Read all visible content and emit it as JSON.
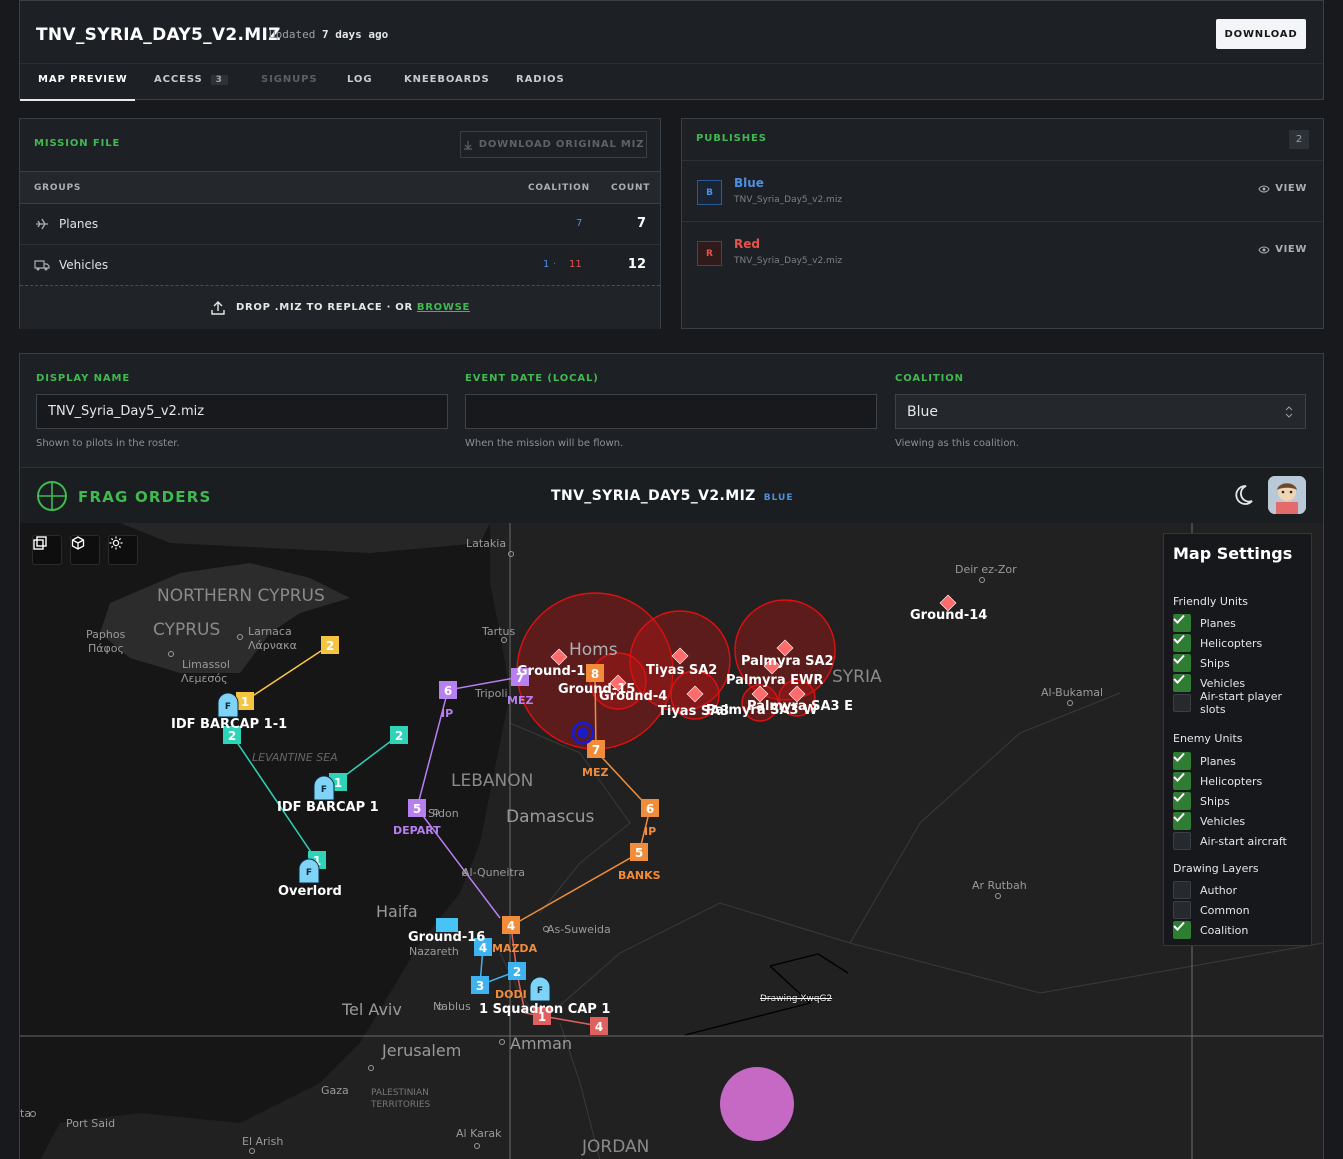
{
  "header": {
    "title": "TNV_SYRIA_DAY5_V2.MIZ",
    "updated_label": "Updated",
    "updated_value": "7 days ago",
    "download_label": "DOWNLOAD"
  },
  "tabs": [
    {
      "label": "MAP PREVIEW"
    },
    {
      "label": "ACCESS",
      "badge": "3"
    },
    {
      "label": "SIGNUPS"
    },
    {
      "label": "LOG"
    },
    {
      "label": "KNEEBOARDS"
    },
    {
      "label": "RADIOS"
    }
  ],
  "mission": {
    "title": "MISSION FILE",
    "download_original": "DOWNLOAD ORIGINAL MIZ",
    "col_groups": "GROUPS",
    "col_coalition": "COALITION",
    "col_count": "COUNT",
    "rows": [
      {
        "name": "Planes",
        "blue": "7",
        "red": "",
        "count": "7"
      },
      {
        "name": "Vehicles",
        "blue": "1",
        "red": "11",
        "count": "12"
      }
    ],
    "drop_text": "DROP .MIZ TO REPLACE · OR",
    "browse": "BROWSE"
  },
  "publishes": {
    "title": "PUBLISHES",
    "count": "2",
    "items": [
      {
        "letter": "B",
        "name": "Blue",
        "file": "TNV_Syria_Day5_v2.miz",
        "view": "VIEW"
      },
      {
        "letter": "R",
        "name": "Red",
        "file": "TNV_Syria_Day5_v2.miz",
        "view": "VIEW"
      }
    ]
  },
  "form": {
    "display_name_label": "DISPLAY NAME",
    "display_name_value": "TNV_Syria_Day5_v2.miz",
    "display_name_hint": "Shown to pilots in the roster.",
    "event_date_label": "EVENT DATE (LOCAL)",
    "event_date_value": "",
    "event_date_hint": "When the mission will be flown.",
    "coalition_label": "COALITION",
    "coalition_value": "Blue",
    "coalition_hint": "Viewing as this coalition."
  },
  "frag": {
    "title": "FRAG ORDERS",
    "mission_name": "TNV_SYRIA_DAY5_V2.MIZ",
    "coalition_tag": "BLUE"
  },
  "map": {
    "places": [
      "Latakia",
      "Deir ez-Zor",
      "NORTHERN CYPRUS",
      "CYPRUS",
      "Paphos",
      "Πάφος",
      "Larnaca",
      "Λάρνακα",
      "Limassol",
      "Λεμεσός",
      "Tartus",
      "Homs",
      "Tripoli",
      "SYRIA",
      "Al-Bukamal",
      "LEVANTINE SEA",
      "LEBANON",
      "Damascus",
      "Sidon",
      "Al-Quneitra",
      "Haifa",
      "Nazareth",
      "As-Suweida",
      "Ar Rutbah",
      "Tel Aviv",
      "Nablus",
      "Jerusalem",
      "Amman",
      "Gaza",
      "PALESTINIAN",
      "TERRITORIES",
      "Al Karak",
      "Port Said",
      "El Arish",
      "JORDAN",
      "ta"
    ],
    "units": [
      "IDF BARCAP 1-1",
      "IDF BARCAP 1",
      "Overlord",
      "Ground-16",
      "Ground-14",
      "Tiyas SA2",
      "Palmyra SA2",
      "Palmyra EWR",
      "Ground-1",
      "Ground-4",
      "Ground-15",
      "Tiyas SA3",
      "Palmyra SA3 E",
      "Palmyra SA3 W",
      "1 Squadron CAP 1"
    ],
    "waypoint_labels": [
      "IP",
      "MEZ",
      "DEPART",
      "BANKS",
      "MAZDA",
      "DODI"
    ],
    "drawing": "Drawing-XwqG2"
  },
  "settings": {
    "title": "Map Settings",
    "friendly_title": "Friendly Units",
    "friendly": [
      {
        "label": "Planes",
        "on": true
      },
      {
        "label": "Helicopters",
        "on": true
      },
      {
        "label": "Ships",
        "on": true
      },
      {
        "label": "Vehicles",
        "on": true
      },
      {
        "label": "Air-start player slots",
        "on": false
      }
    ],
    "enemy_title": "Enemy Units",
    "enemy": [
      {
        "label": "Planes",
        "on": true
      },
      {
        "label": "Helicopters",
        "on": true
      },
      {
        "label": "Ships",
        "on": true
      },
      {
        "label": "Vehicles",
        "on": true
      },
      {
        "label": "Air-start aircraft",
        "on": false
      }
    ],
    "layers_title": "Drawing Layers",
    "layers": [
      {
        "label": "Author",
        "on": false
      },
      {
        "label": "Common",
        "on": false
      },
      {
        "label": "Coalition",
        "on": true
      }
    ]
  },
  "colors": {
    "accent": "#3fb950",
    "blue": "#4f8fe0",
    "red": "#e5534b",
    "threat": "#d01010",
    "flight_orange": "#f08c3a",
    "flight_purple": "#b77ff0",
    "flight_yellow": "#f5c542",
    "flight_teal": "#2fd3b8"
  }
}
